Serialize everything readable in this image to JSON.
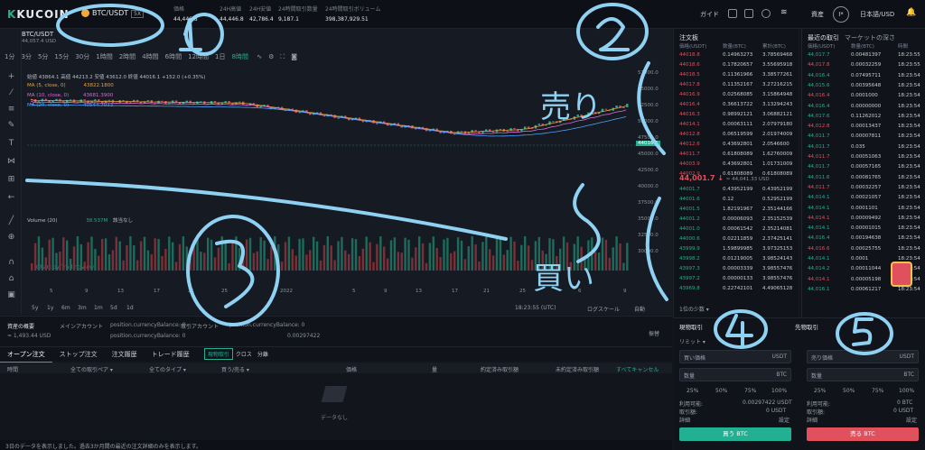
{
  "header": {
    "logo": "KUCOIN",
    "pair": "BTC/USDT",
    "leverage": "5X",
    "stats": [
      {
        "label": "価格",
        "value": "44,446.8"
      },
      {
        "label": "24H高値",
        "value": "44,446.8"
      },
      {
        "label": "24H安値",
        "value": "42,786.4"
      },
      {
        "label": "24時間取引数量",
        "value": "9,187.1"
      },
      {
        "label": "24時間取引ボリューム",
        "value": "398,387,929.51"
      }
    ],
    "guide": "ガイド",
    "assets": "資産",
    "lang": "日本語/USD",
    "avatar": "I*"
  },
  "chart": {
    "symbol": "BTC/USDT",
    "subprice": "44,057.4 USD",
    "timeframes": [
      "1分",
      "3分",
      "5分",
      "15分",
      "30分",
      "1時間",
      "2時間",
      "4時間",
      "6時間",
      "12時間",
      "1日",
      "8時間"
    ],
    "ohlc": "始値 43864.1  高値 44213.2  安値 43612.0  終値 44016.1  +152.0 (+0.35%)",
    "ma": [
      {
        "label": "MA (5, close, 0)",
        "value": "43822.1800",
        "color": "#e6a23c"
      },
      {
        "label": "MA (10, close, 0)",
        "value": "43681.3900",
        "color": "#d66bd6"
      },
      {
        "label": "MA (20, close, 0)",
        "value": "40544.7033",
        "color": "#4aa3ff"
      }
    ],
    "volume": "Volume (20)",
    "volume_value": "38.537M",
    "volume_note": "該当なし",
    "watermark": "Chart by TradingView",
    "price_ticks": [
      "57000.0",
      "55000.0",
      "52500.0",
      "50000.0",
      "47500.0",
      "45000.0",
      "42500.0",
      "40000.0",
      "37500.0",
      "35000.0",
      "32500.0",
      "30000.0"
    ],
    "x_ticks": [
      "5",
      "9",
      "13",
      "17",
      "21",
      "25",
      "2022",
      "5",
      "9",
      "13",
      "17",
      "21",
      "25",
      "6",
      "9"
    ],
    "last_price": "44016.1",
    "time": "18:23:55 (UTC)",
    "log_scale": "ログスケール",
    "auto": "自動",
    "ranges": [
      "5y",
      "1y",
      "6m",
      "3m",
      "1m",
      "5d",
      "1d"
    ]
  },
  "asset_bar": {
    "overview": "資産の概要",
    "main": "メインアカウント",
    "bal1": "position.currencyBalance: 0",
    "trade": "取引アカウント",
    "bal2": "position.currencyBalance: 0",
    "value": "≈ 1,493.44 USD",
    "detail": "0.00297422",
    "deposit": "振替"
  },
  "tabs": [
    "オープン注文",
    "ストップ注文",
    "注文履歴",
    "トレード履歴"
  ],
  "tab_filters": [
    "現物取引",
    "クロス",
    "分離"
  ],
  "order_hdr": [
    "時間",
    "全ての取引ペア ▾",
    "全てのタイプ ▾",
    "買う/売る ▾",
    "価格",
    "量",
    "約定済み取引額",
    "未約定済み取引額",
    "すべてキャンセル"
  ],
  "empty": "データなし",
  "footer": "3日のデータを表示しました。過去3か月間の最近の注文詳細のみを表示します。",
  "orderbook": {
    "title": "注文板",
    "cols": [
      "価格(USDT)",
      "数量(BTC)",
      "累計(BTC)"
    ],
    "asks": [
      [
        "44018.8",
        "0.14963273",
        "3.78569468"
      ],
      [
        "44018.6",
        "0.17820657",
        "3.55695918"
      ],
      [
        "44018.5",
        "0.11361966",
        "3.38577261"
      ],
      [
        "44017.8",
        "0.11352167",
        "3.27216215"
      ],
      [
        "44016.9",
        "0.02568085",
        "3.15864948"
      ],
      [
        "44016.4",
        "0.36613722",
        "3.13294243"
      ],
      [
        "44016.3",
        "0.98992121",
        "3.06882121"
      ],
      [
        "44014.1",
        "0.00063111",
        "2.07979180"
      ],
      [
        "44012.8",
        "0.06519599",
        "2.01974009"
      ],
      [
        "44012.6",
        "0.43692801",
        "2.0546600"
      ],
      [
        "44011.7",
        "0.61808089",
        "1.62760009"
      ],
      [
        "44003.9",
        "0.43692801",
        "1.01731009"
      ],
      [
        "44002.9",
        "0.61808089",
        "0.61808089"
      ]
    ],
    "mid": "44,001.7 ↓",
    "mid_usd": "≈ 44,041.33 USD",
    "bids": [
      [
        "44001.7",
        "0.43952199",
        "0.43952199"
      ],
      [
        "44001.6",
        "0.12",
        "0.52952199"
      ],
      [
        "44001.5",
        "1.82191967",
        "2.35144166"
      ],
      [
        "44001.2",
        "0.00006093",
        "2.35152539"
      ],
      [
        "44001.0",
        "0.00061542",
        "2.35214081"
      ],
      [
        "44000.6",
        "0.02211859",
        "2.37425141"
      ],
      [
        "43999.9",
        "1.59899985",
        "3.97325153"
      ],
      [
        "43998.2",
        "0.01219005",
        "3.98524143"
      ],
      [
        "43997.3",
        "0.00003339",
        "3.98557476"
      ],
      [
        "43997.2",
        "0.00000133",
        "3.98557476"
      ],
      [
        "43969.8",
        "0.22742101",
        "4.49065128"
      ]
    ],
    "depth": "1位の少数 ▾"
  },
  "trades": {
    "tabs": [
      "最近の取引",
      "マーケットの深さ"
    ],
    "cols": [
      "価格(USDT)",
      "数量(BTC)",
      "時間"
    ],
    "rows": [
      [
        "44,017.7",
        "0.00481397",
        "18:23:55"
      ],
      [
        "44,017.8",
        "0.00032259",
        "18:23:55"
      ],
      [
        "44,016.4",
        "0.07495711",
        "18:23:54"
      ],
      [
        "44,015.6",
        "0.00395648",
        "18:23:54"
      ],
      [
        "44,016.4",
        "0.0001000",
        "18:23:54"
      ],
      [
        "44,016.4",
        "0.00000000",
        "18:23:54"
      ],
      [
        "44,017.6",
        "0.11262012",
        "18:23:54"
      ],
      [
        "44,012.8",
        "0.00013437",
        "18:23:54"
      ],
      [
        "44,011.7",
        "0.00007811",
        "18:23:54"
      ],
      [
        "44,011.7",
        "0.035",
        "18:23:54"
      ],
      [
        "44,011.7",
        "0.00051063",
        "18:23:54"
      ],
      [
        "44,011.7",
        "0.00057165",
        "18:23:54"
      ],
      [
        "44,011.6",
        "0.00081765",
        "18:23:54"
      ],
      [
        "44,011.7",
        "0.00032257",
        "18:23:54"
      ],
      [
        "44,014.1",
        "0.00021057",
        "18:23:54"
      ],
      [
        "44,014.1",
        "0.0001101",
        "18:23:54"
      ],
      [
        "44,014.1",
        "0.00009492",
        "18:23:54"
      ],
      [
        "44,014.1",
        "0.00001015",
        "18:23:54"
      ],
      [
        "44,016.4",
        "0.00194638",
        "18:23:54"
      ],
      [
        "44,016.6",
        "0.00025755",
        "18:23:54"
      ],
      [
        "44,014.1",
        "0.0001",
        "18:23:54"
      ],
      [
        "44,014.2",
        "0.00011044",
        "18:23:54"
      ],
      [
        "44,014.1",
        "0.00005198",
        "18:23:54"
      ],
      [
        "44,016.1",
        "0.00061217",
        "18:23:54"
      ]
    ]
  },
  "buy": {
    "tab": "現物取引",
    "mode": "リミット ▾",
    "price_ph": "買い価格",
    "unit": "USDT",
    "qty_ph": "数量",
    "qty_unit": "BTC",
    "pcts": [
      "25%",
      "50%",
      "75%",
      "100%"
    ],
    "avail_label": "利用可能:",
    "avail": "0.00297422 USDT",
    "fee_label": "取引額:",
    "fee": "0 USDT",
    "detail": "詳細",
    "setting": "設定",
    "button": "買う BTC"
  },
  "sell": {
    "tab": "先物取引",
    "price_ph": "売り価格",
    "unit": "USDT",
    "qty_ph": "数量",
    "qty_unit": "BTC",
    "pcts": [
      "25%",
      "50%",
      "75%",
      "100%"
    ],
    "avail_label": "利用可能:",
    "avail": "0 BTC",
    "fee_label": "取引額:",
    "fee": "0 USDT",
    "detail": "詳細",
    "setting": "設定",
    "button": "売る BTC"
  },
  "annotations": {
    "sell": "売り",
    "buy": "買い"
  }
}
